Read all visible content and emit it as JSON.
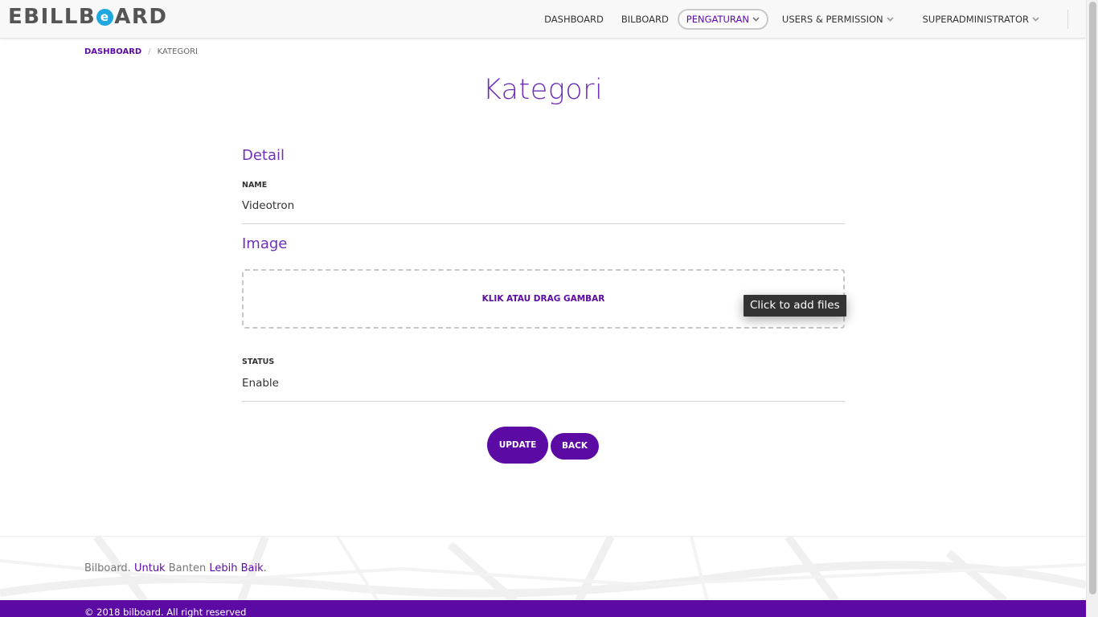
{
  "app": {
    "logo_parts": [
      "EBILLB",
      "e",
      "ARD"
    ]
  },
  "nav": {
    "items": [
      {
        "label": "DASHBOARD",
        "dropdown": false,
        "active": false
      },
      {
        "label": "BILBOARD",
        "dropdown": false,
        "active": false
      },
      {
        "label": "PENGATURAN",
        "dropdown": true,
        "active": true
      },
      {
        "label": "USERS & PERMISSION",
        "dropdown": true,
        "active": false
      },
      {
        "label": "SUPERADMINISTRATOR",
        "dropdown": true,
        "active": false
      }
    ]
  },
  "breadcrumb": {
    "home": "DASHBOARD",
    "separator": "/",
    "current": "KATEGORI"
  },
  "page": {
    "title": "Kategori"
  },
  "form": {
    "detail_title": "Detail",
    "name_label": "NAME",
    "name_value": "Videotron",
    "image_title": "Image",
    "dropzone_text": "KLIK ATAU DRAG GAMBAR",
    "dropzone_tooltip": "Click to add files",
    "status_label": "STATUS",
    "status_value": "Enable",
    "update_label": "UPDATE",
    "back_label": "BACK"
  },
  "footer": {
    "tagline_1": "Bilboard.",
    "tagline_2": "Untuk",
    "tagline_3": "Banten",
    "tagline_4": "Lebih Baik",
    "tagline_5": ".",
    "copyright": "© 2018 bilboard. All right reserved"
  },
  "colors": {
    "accent": "#5b0aa3",
    "title": "#6f2fb8",
    "logo_circle": "#1fa7e0"
  }
}
